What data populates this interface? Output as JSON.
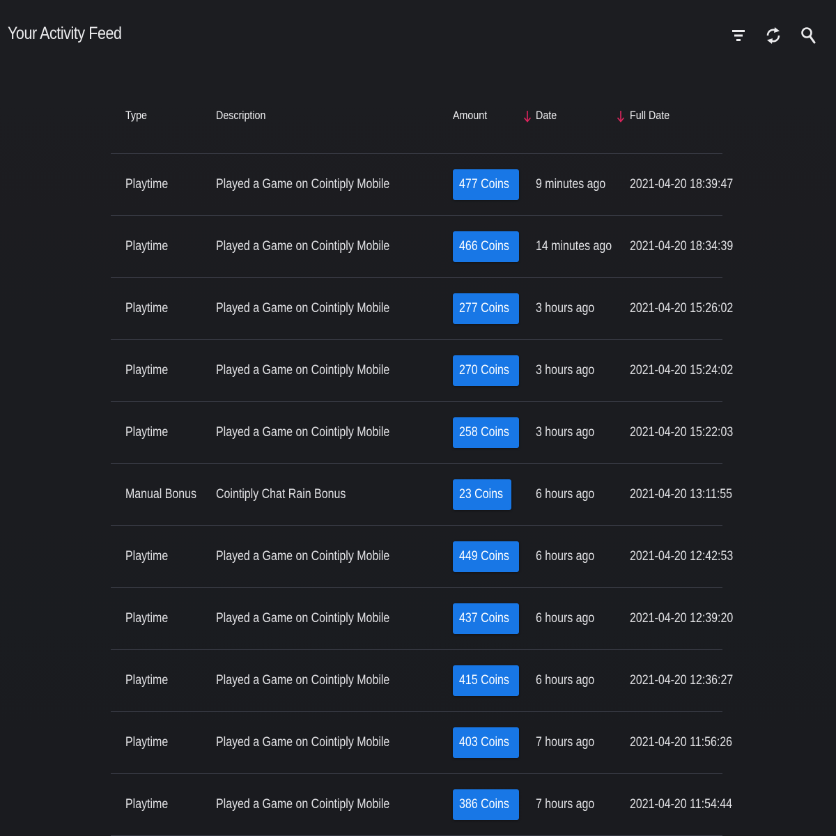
{
  "header": {
    "title": "Your Activity Feed",
    "icons": [
      "filter-icon",
      "refresh-icon",
      "search-icon"
    ]
  },
  "colors": {
    "background": "#1b1c20",
    "badge": "#1877e6",
    "sort_arrow": "#e0245e",
    "divider": "#3a3c46"
  },
  "table": {
    "columns": {
      "type": "Type",
      "description": "Description",
      "amount": "Amount",
      "date": "Date",
      "full_date": "Full Date"
    },
    "rows": [
      {
        "type": "Playtime",
        "description": "Played a Game on Cointiply Mobile",
        "amount": "477 Coins",
        "date": "9 minutes ago",
        "full_date": "2021-04-20 18:39:47"
      },
      {
        "type": "Playtime",
        "description": "Played a Game on Cointiply Mobile",
        "amount": "466 Coins",
        "date": "14 minutes ago",
        "full_date": "2021-04-20 18:34:39"
      },
      {
        "type": "Playtime",
        "description": "Played a Game on Cointiply Mobile",
        "amount": "277 Coins",
        "date": "3 hours ago",
        "full_date": "2021-04-20 15:26:02"
      },
      {
        "type": "Playtime",
        "description": "Played a Game on Cointiply Mobile",
        "amount": "270 Coins",
        "date": "3 hours ago",
        "full_date": "2021-04-20 15:24:02"
      },
      {
        "type": "Playtime",
        "description": "Played a Game on Cointiply Mobile",
        "amount": "258 Coins",
        "date": "3 hours ago",
        "full_date": "2021-04-20 15:22:03"
      },
      {
        "type": "Manual Bonus",
        "description": "Cointiply Chat Rain Bonus",
        "amount": "23 Coins",
        "date": "6 hours ago",
        "full_date": "2021-04-20 13:11:55"
      },
      {
        "type": "Playtime",
        "description": "Played a Game on Cointiply Mobile",
        "amount": "449 Coins",
        "date": "6 hours ago",
        "full_date": "2021-04-20 12:42:53"
      },
      {
        "type": "Playtime",
        "description": "Played a Game on Cointiply Mobile",
        "amount": "437 Coins",
        "date": "6 hours ago",
        "full_date": "2021-04-20 12:39:20"
      },
      {
        "type": "Playtime",
        "description": "Played a Game on Cointiply Mobile",
        "amount": "415 Coins",
        "date": "6 hours ago",
        "full_date": "2021-04-20 12:36:27"
      },
      {
        "type": "Playtime",
        "description": "Played a Game on Cointiply Mobile",
        "amount": "403 Coins",
        "date": "7 hours ago",
        "full_date": "2021-04-20 11:56:26"
      },
      {
        "type": "Playtime",
        "description": "Played a Game on Cointiply Mobile",
        "amount": "386 Coins",
        "date": "7 hours ago",
        "full_date": "2021-04-20 11:54:44"
      }
    ]
  }
}
